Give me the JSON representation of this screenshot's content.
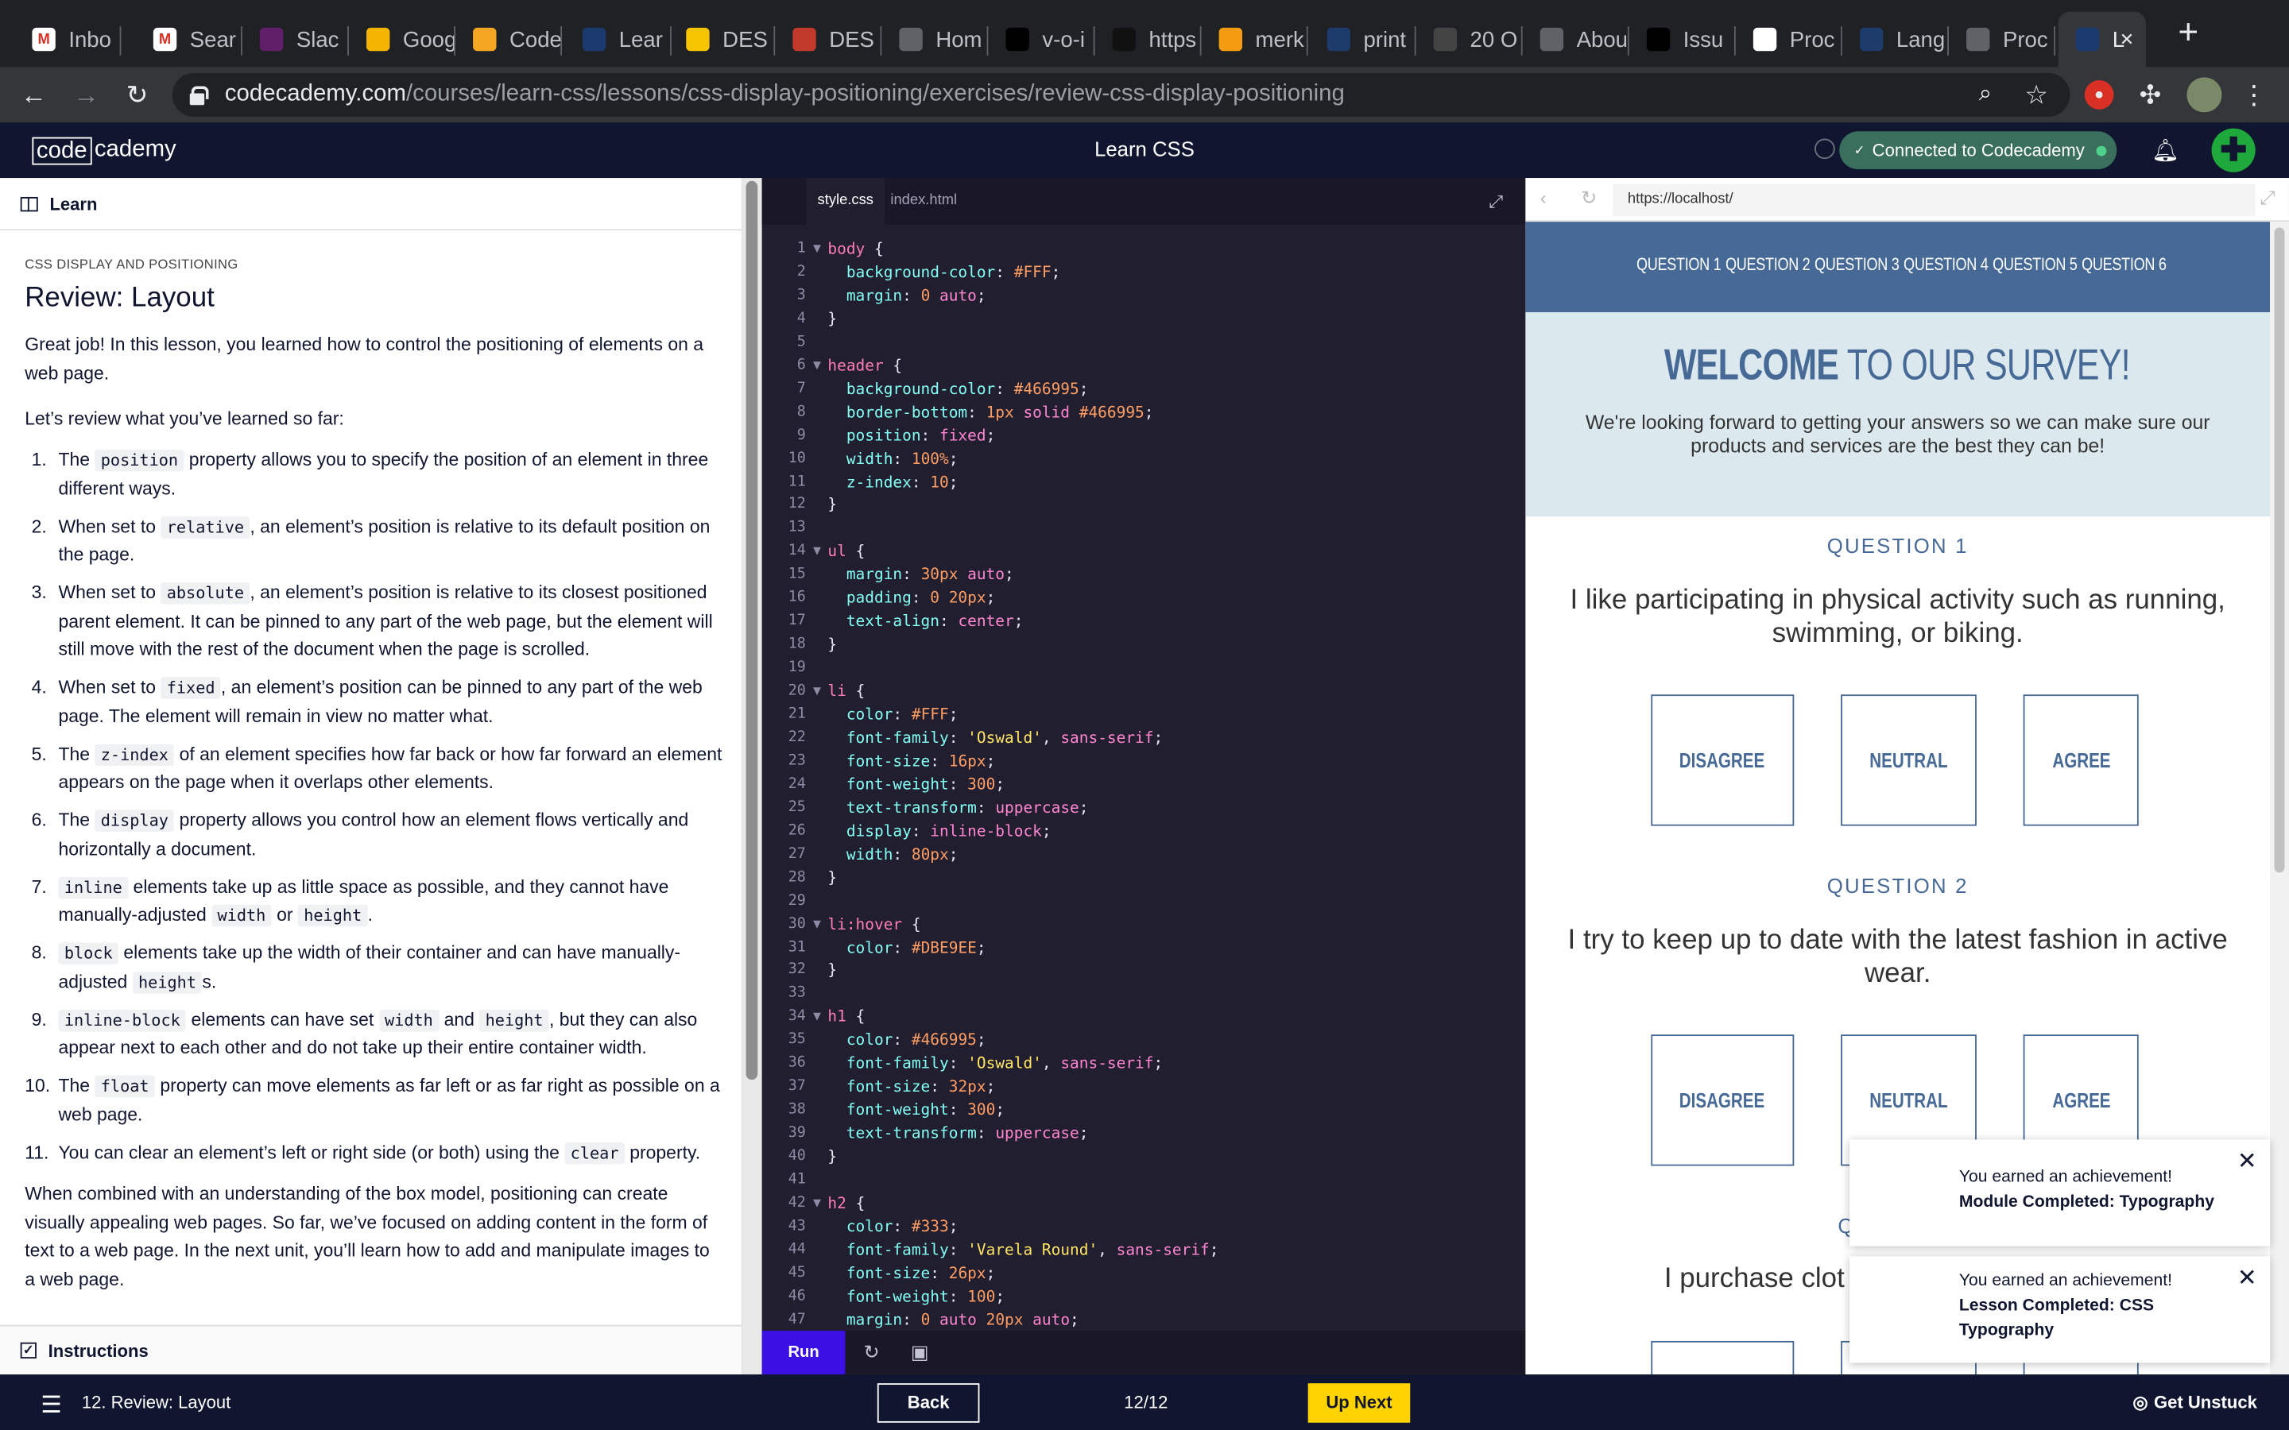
{
  "browser": {
    "tabs": [
      {
        "label": "Inbo",
        "favicon": "gmail-icon"
      },
      {
        "label": "Sear",
        "favicon": "gmail-icon"
      },
      {
        "label": "Slac",
        "favicon": "slack-icon"
      },
      {
        "label": "Goog",
        "favicon": "google-slides-icon"
      },
      {
        "label": "Code",
        "favicon": "codecademy-icon"
      },
      {
        "label": "Lear",
        "favicon": "codecademy-learn-icon"
      },
      {
        "label": "DES",
        "favicon": "des-icon"
      },
      {
        "label": "DES",
        "favicon": "des-icon-2"
      },
      {
        "label": "Hom",
        "favicon": "globe-icon"
      },
      {
        "label": "v-o-i",
        "favicon": "video-icon"
      },
      {
        "label": "https",
        "favicon": "site-icon"
      },
      {
        "label": "merk",
        "favicon": "chat-icon"
      },
      {
        "label": "print",
        "favicon": "p-icon"
      },
      {
        "label": "20 O",
        "favicon": "quote-icon"
      },
      {
        "label": "Abou",
        "favicon": "globe-icon"
      },
      {
        "label": "Issu",
        "favicon": "github-icon"
      },
      {
        "label": "Proc",
        "favicon": "doc-icon"
      },
      {
        "label": "Lang",
        "favicon": "p-icon"
      },
      {
        "label": "Proc",
        "favicon": "globe-icon"
      },
      {
        "label": "L",
        "favicon": "codecademy-learn-icon"
      }
    ],
    "url_host": "codecademy.com",
    "url_path": "/courses/learn-css/lessons/css-display-positioning/exercises/review-css-display-positioning"
  },
  "app": {
    "logo_code": "code",
    "logo_rest": "cademy",
    "course_title": "Learn CSS",
    "connected": "Connected to Codecademy",
    "avatar_glyph": "✚"
  },
  "lesson": {
    "learn_label": "Learn",
    "breadcrumb": "CSS DISPLAY AND POSITIONING",
    "title": "Review: Layout",
    "intro": "Great job! In this lesson, you learned how to control the positioning of elements on a web page.",
    "review_lead": "Let’s review what you’ve learned so far:",
    "items": [
      {
        "n": "1.",
        "parts": [
          "The ",
          {
            "code": "position"
          },
          " property allows you to specify the position of an element in three different ways."
        ]
      },
      {
        "n": "2.",
        "parts": [
          "When set to ",
          {
            "code": "relative"
          },
          ", an element’s position is relative to its default position on the page."
        ]
      },
      {
        "n": "3.",
        "parts": [
          "When set to ",
          {
            "code": "absolute"
          },
          ", an element’s position is relative to its closest positioned parent element. It can be pinned to any part of the web page, but the element will still move with the rest of the document when the page is scrolled."
        ]
      },
      {
        "n": "4.",
        "parts": [
          "When set to ",
          {
            "code": "fixed"
          },
          ", an element’s position can be pinned to any part of the web page. The element will remain in view no matter what."
        ]
      },
      {
        "n": "5.",
        "parts": [
          "The ",
          {
            "code": "z-index"
          },
          " of an element specifies how far back or how far forward an element appears on the page when it overlaps other elements."
        ]
      },
      {
        "n": "6.",
        "parts": [
          "The ",
          {
            "code": "display"
          },
          " property allows you control how an element flows vertically and horizontally a document."
        ]
      },
      {
        "n": "7.",
        "parts": [
          {
            "code": "inline"
          },
          " elements take up as little space as possible, and they cannot have manually-adjusted ",
          {
            "code": "width"
          },
          " or ",
          {
            "code": "height"
          },
          "."
        ]
      },
      {
        "n": "8.",
        "parts": [
          {
            "code": "block"
          },
          " elements take up the width of their container and can have manually-adjusted ",
          {
            "code": "height"
          },
          "s."
        ]
      },
      {
        "n": "9.",
        "parts": [
          {
            "code": "inline-block"
          },
          " elements can have set ",
          {
            "code": "width"
          },
          " and ",
          {
            "code": "height"
          },
          ", but they can also appear next to each other and do not take up their entire container width."
        ]
      },
      {
        "n": "10.",
        "parts": [
          "The ",
          {
            "code": "float"
          },
          " property can move elements as far left or as far right as possible on a web page."
        ]
      },
      {
        "n": "11.",
        "parts": [
          "You can clear an element’s left or right side (or both) using the ",
          {
            "code": "clear"
          },
          " property."
        ]
      }
    ],
    "outro": "When combined with an understanding of the box model, positioning can create visually appealing web pages. So far, we’ve focused on adding content in the form of text to a web page. In the next unit, you’ll learn how to add and manipulate images to a web page.",
    "instructions_label": "Instructions"
  },
  "editor": {
    "tabs": [
      "style.css",
      "index.html"
    ],
    "run_label": "Run",
    "lines": [
      [
        [
          "sel",
          "body"
        ],
        [
          "pun",
          " {"
        ]
      ],
      [
        [
          "prop",
          "  background-color"
        ],
        [
          "pun",
          ": "
        ],
        [
          "num",
          "#FFF"
        ],
        [
          "pun",
          ";"
        ]
      ],
      [
        [
          "prop",
          "  margin"
        ],
        [
          "pun",
          ": "
        ],
        [
          "num",
          "0"
        ],
        [
          "val",
          " auto"
        ],
        [
          "pun",
          ";"
        ]
      ],
      [
        [
          "pun",
          "}"
        ]
      ],
      [],
      [
        [
          "sel",
          "header"
        ],
        [
          "pun",
          " {"
        ]
      ],
      [
        [
          "prop",
          "  background-color"
        ],
        [
          "pun",
          ": "
        ],
        [
          "num",
          "#466995"
        ],
        [
          "pun",
          ";"
        ]
      ],
      [
        [
          "prop",
          "  border-bottom"
        ],
        [
          "pun",
          ": "
        ],
        [
          "num",
          "1px"
        ],
        [
          "val",
          " solid"
        ],
        [
          "num",
          " #466995"
        ],
        [
          "pun",
          ";"
        ]
      ],
      [
        [
          "prop",
          "  position"
        ],
        [
          "pun",
          ": "
        ],
        [
          "val",
          "fixed"
        ],
        [
          "pun",
          ";"
        ]
      ],
      [
        [
          "prop",
          "  width"
        ],
        [
          "pun",
          ": "
        ],
        [
          "num",
          "100%"
        ],
        [
          "pun",
          ";"
        ]
      ],
      [
        [
          "prop",
          "  z-index"
        ],
        [
          "pun",
          ": "
        ],
        [
          "num",
          "10"
        ],
        [
          "pun",
          ";"
        ]
      ],
      [
        [
          "pun",
          "}"
        ]
      ],
      [],
      [
        [
          "sel",
          "ul"
        ],
        [
          "pun",
          " {"
        ]
      ],
      [
        [
          "prop",
          "  margin"
        ],
        [
          "pun",
          ": "
        ],
        [
          "num",
          "30px"
        ],
        [
          "val",
          " auto"
        ],
        [
          "pun",
          ";"
        ]
      ],
      [
        [
          "prop",
          "  padding"
        ],
        [
          "pun",
          ": "
        ],
        [
          "num",
          "0 20px"
        ],
        [
          "pun",
          ";"
        ]
      ],
      [
        [
          "prop",
          "  text-align"
        ],
        [
          "pun",
          ": "
        ],
        [
          "val",
          "center"
        ],
        [
          "pun",
          ";"
        ]
      ],
      [
        [
          "pun",
          "}"
        ]
      ],
      [],
      [
        [
          "sel",
          "li"
        ],
        [
          "pun",
          " {"
        ]
      ],
      [
        [
          "prop",
          "  color"
        ],
        [
          "pun",
          ": "
        ],
        [
          "num",
          "#FFF"
        ],
        [
          "pun",
          ";"
        ]
      ],
      [
        [
          "prop",
          "  font-family"
        ],
        [
          "pun",
          ": "
        ],
        [
          "str",
          "'Oswald'"
        ],
        [
          "pun",
          ", "
        ],
        [
          "val",
          "sans-serif"
        ],
        [
          "pun",
          ";"
        ]
      ],
      [
        [
          "prop",
          "  font-size"
        ],
        [
          "pun",
          ": "
        ],
        [
          "num",
          "16px"
        ],
        [
          "pun",
          ";"
        ]
      ],
      [
        [
          "prop",
          "  font-weight"
        ],
        [
          "pun",
          ": "
        ],
        [
          "num",
          "300"
        ],
        [
          "pun",
          ";"
        ]
      ],
      [
        [
          "prop",
          "  text-transform"
        ],
        [
          "pun",
          ": "
        ],
        [
          "val",
          "uppercase"
        ],
        [
          "pun",
          ";"
        ]
      ],
      [
        [
          "prop",
          "  display"
        ],
        [
          "pun",
          ": "
        ],
        [
          "val",
          "inline-block"
        ],
        [
          "pun",
          ";"
        ]
      ],
      [
        [
          "prop",
          "  width"
        ],
        [
          "pun",
          ": "
        ],
        [
          "num",
          "80px"
        ],
        [
          "pun",
          ";"
        ]
      ],
      [
        [
          "pun",
          "}"
        ]
      ],
      [],
      [
        [
          "sel",
          "li:hover"
        ],
        [
          "pun",
          " {"
        ]
      ],
      [
        [
          "prop",
          "  color"
        ],
        [
          "pun",
          ": "
        ],
        [
          "num",
          "#DBE9EE"
        ],
        [
          "pun",
          ";"
        ]
      ],
      [
        [
          "pun",
          "}"
        ]
      ],
      [],
      [
        [
          "sel",
          "h1"
        ],
        [
          "pun",
          " {"
        ]
      ],
      [
        [
          "prop",
          "  color"
        ],
        [
          "pun",
          ": "
        ],
        [
          "num",
          "#466995"
        ],
        [
          "pun",
          ";"
        ]
      ],
      [
        [
          "prop",
          "  font-family"
        ],
        [
          "pun",
          ": "
        ],
        [
          "str",
          "'Oswald'"
        ],
        [
          "pun",
          ", "
        ],
        [
          "val",
          "sans-serif"
        ],
        [
          "pun",
          ";"
        ]
      ],
      [
        [
          "prop",
          "  font-size"
        ],
        [
          "pun",
          ": "
        ],
        [
          "num",
          "32px"
        ],
        [
          "pun",
          ";"
        ]
      ],
      [
        [
          "prop",
          "  font-weight"
        ],
        [
          "pun",
          ": "
        ],
        [
          "num",
          "300"
        ],
        [
          "pun",
          ";"
        ]
      ],
      [
        [
          "prop",
          "  text-transform"
        ],
        [
          "pun",
          ": "
        ],
        [
          "val",
          "uppercase"
        ],
        [
          "pun",
          ";"
        ]
      ],
      [
        [
          "pun",
          "}"
        ]
      ],
      [],
      [
        [
          "sel",
          "h2"
        ],
        [
          "pun",
          " {"
        ]
      ],
      [
        [
          "prop",
          "  color"
        ],
        [
          "pun",
          ": "
        ],
        [
          "num",
          "#333"
        ],
        [
          "pun",
          ";"
        ]
      ],
      [
        [
          "prop",
          "  font-family"
        ],
        [
          "pun",
          ": "
        ],
        [
          "str",
          "'Varela Round'"
        ],
        [
          "pun",
          ", "
        ],
        [
          "val",
          "sans-serif"
        ],
        [
          "pun",
          ";"
        ]
      ],
      [
        [
          "prop",
          "  font-size"
        ],
        [
          "pun",
          ": "
        ],
        [
          "num",
          "26px"
        ],
        [
          "pun",
          ";"
        ]
      ],
      [
        [
          "prop",
          "  font-weight"
        ],
        [
          "pun",
          ": "
        ],
        [
          "num",
          "100"
        ],
        [
          "pun",
          ";"
        ]
      ],
      [
        [
          "prop",
          "  margin"
        ],
        [
          "pun",
          ": "
        ],
        [
          "num",
          "0"
        ],
        [
          "val",
          " auto"
        ],
        [
          "num",
          " 20px"
        ],
        [
          "val",
          " auto"
        ],
        [
          "pun",
          ";"
        ]
      ]
    ],
    "fold_lines": [
      1,
      6,
      14,
      20,
      30,
      34,
      42
    ]
  },
  "preview": {
    "url": "https://localhost/",
    "nav": [
      "QUESTION 1",
      "QUESTION 2",
      "QUESTION 3",
      "QUESTION 4",
      "QUESTION 5",
      "QUESTION 6"
    ],
    "welcome_bold": "WELCOME",
    "welcome_rest": " TO OUR SURVEY!",
    "intro": "We're looking forward to getting your answers so we can make sure our products and services are the best they can be!",
    "questions": [
      {
        "label": "QUESTION 1",
        "text": "I like participating in physical activity such as running, swimming, or biking."
      },
      {
        "label": "QUESTION 2",
        "text": "I try to keep up to date with the latest fashion in active wear."
      },
      {
        "label": "Q",
        "text": "I purchase clot"
      }
    ],
    "answers": [
      "DISAGREE",
      "NEUTRAL",
      "AGREE"
    ]
  },
  "toasts": [
    {
      "title": "You earned an achievement!",
      "body": "Module Completed: Typography"
    },
    {
      "title": "You earned an achievement!",
      "body": "Lesson Completed: CSS Typography"
    }
  ],
  "footer": {
    "title": "12. Review: Layout",
    "back": "Back",
    "pager": "12/12",
    "next": "Up Next",
    "unstuck": "Get Unstuck"
  },
  "colors": {
    "codecademy_navy": "#10162f",
    "run_blue": "#3a10e5",
    "next_yellow": "#ffd300",
    "survey_blue": "#466995",
    "survey_light": "#dbe9ee"
  }
}
